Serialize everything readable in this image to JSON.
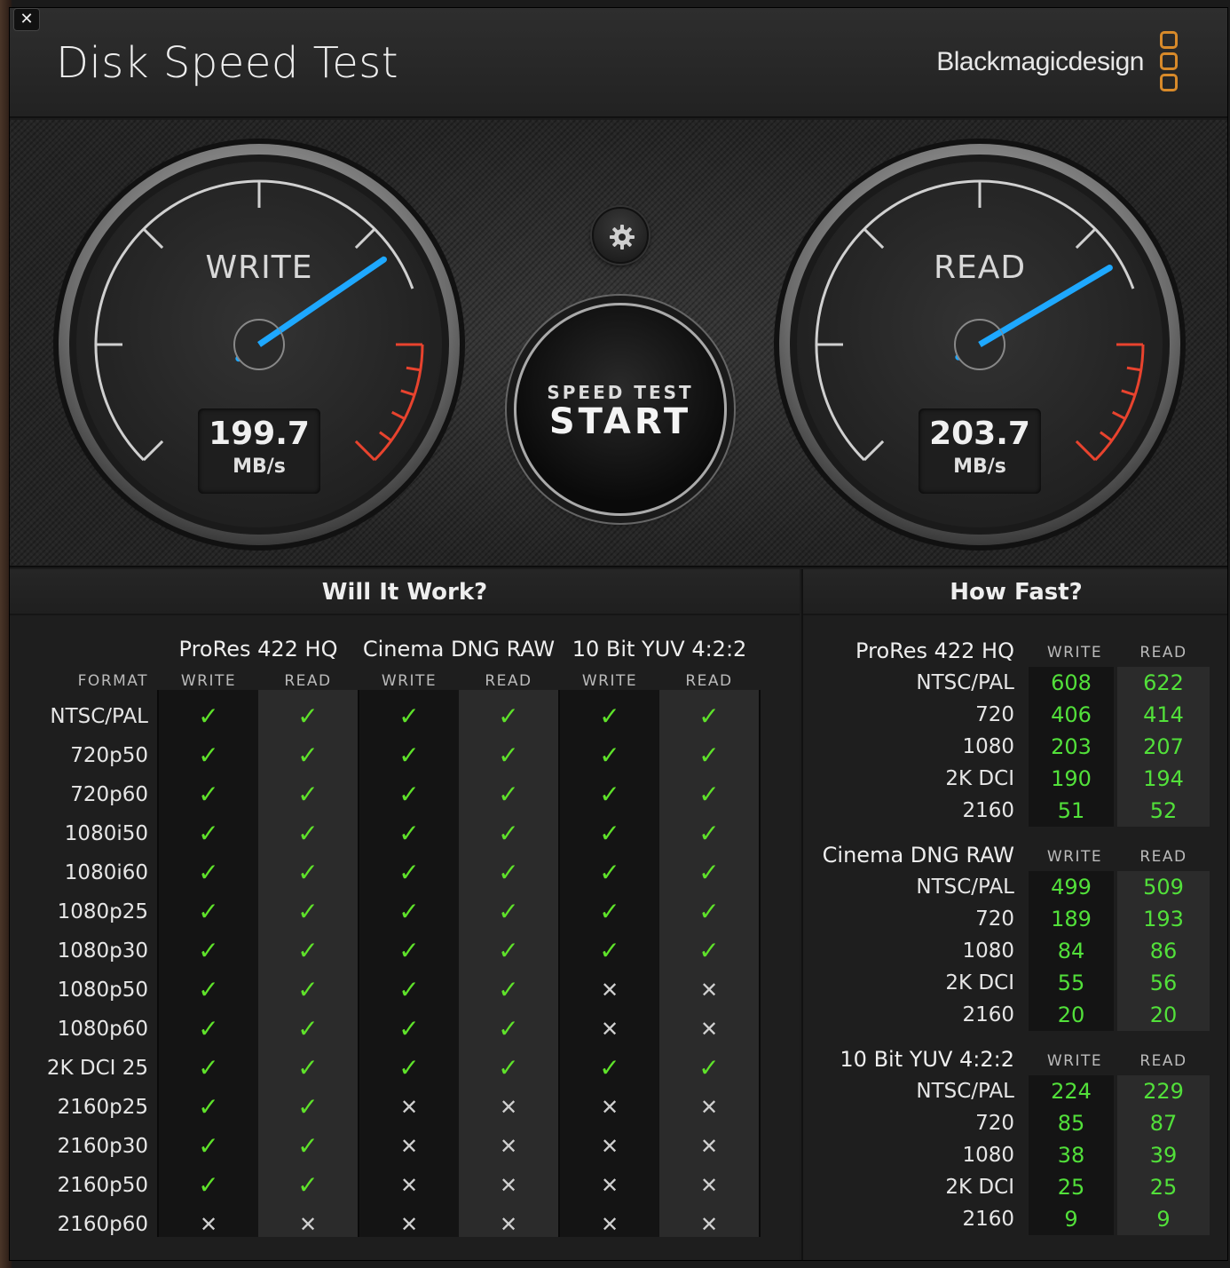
{
  "window": {
    "title": "Disk Speed Test",
    "brand": "Blackmagicdesign",
    "close_glyph": "✕"
  },
  "gauges": {
    "write": {
      "label": "WRITE",
      "value": "199.7",
      "unit": "MB/s"
    },
    "read": {
      "label": "READ",
      "value": "203.7",
      "unit": "MB/s"
    }
  },
  "controls": {
    "settings_icon": "gear-icon",
    "start_small": "SPEED TEST",
    "start_big": "START"
  },
  "will_it_work": {
    "title": "Will It Work?",
    "format_header": "FORMAT",
    "groups": [
      "ProRes 422 HQ",
      "Cinema DNG RAW",
      "10 Bit YUV 4:2:2"
    ],
    "col_write": "WRITE",
    "col_read": "READ",
    "yes_glyph": "✓",
    "no_glyph": "✕",
    "rows": [
      {
        "format": "NTSC/PAL",
        "v": [
          1,
          1,
          1,
          1,
          1,
          1
        ]
      },
      {
        "format": "720p50",
        "v": [
          1,
          1,
          1,
          1,
          1,
          1
        ]
      },
      {
        "format": "720p60",
        "v": [
          1,
          1,
          1,
          1,
          1,
          1
        ]
      },
      {
        "format": "1080i50",
        "v": [
          1,
          1,
          1,
          1,
          1,
          1
        ]
      },
      {
        "format": "1080i60",
        "v": [
          1,
          1,
          1,
          1,
          1,
          1
        ]
      },
      {
        "format": "1080p25",
        "v": [
          1,
          1,
          1,
          1,
          1,
          1
        ]
      },
      {
        "format": "1080p30",
        "v": [
          1,
          1,
          1,
          1,
          1,
          1
        ]
      },
      {
        "format": "1080p50",
        "v": [
          1,
          1,
          1,
          1,
          0,
          0
        ]
      },
      {
        "format": "1080p60",
        "v": [
          1,
          1,
          1,
          1,
          0,
          0
        ]
      },
      {
        "format": "2K DCI 25",
        "v": [
          1,
          1,
          1,
          1,
          1,
          1
        ]
      },
      {
        "format": "2160p25",
        "v": [
          1,
          1,
          0,
          0,
          0,
          0
        ]
      },
      {
        "format": "2160p30",
        "v": [
          1,
          1,
          0,
          0,
          0,
          0
        ]
      },
      {
        "format": "2160p50",
        "v": [
          1,
          1,
          0,
          0,
          0,
          0
        ]
      },
      {
        "format": "2160p60",
        "v": [
          0,
          0,
          0,
          0,
          0,
          0
        ]
      }
    ]
  },
  "how_fast": {
    "title": "How Fast?",
    "col_write": "WRITE",
    "col_read": "READ",
    "groups": [
      {
        "name": "ProRes 422 HQ",
        "rows": [
          {
            "label": "NTSC/PAL",
            "write": "608",
            "read": "622"
          },
          {
            "label": "720",
            "write": "406",
            "read": "414"
          },
          {
            "label": "1080",
            "write": "203",
            "read": "207"
          },
          {
            "label": "2K DCI",
            "write": "190",
            "read": "194"
          },
          {
            "label": "2160",
            "write": "51",
            "read": "52"
          }
        ]
      },
      {
        "name": "Cinema DNG RAW",
        "rows": [
          {
            "label": "NTSC/PAL",
            "write": "499",
            "read": "509"
          },
          {
            "label": "720",
            "write": "189",
            "read": "193"
          },
          {
            "label": "1080",
            "write": "84",
            "read": "86"
          },
          {
            "label": "2K DCI",
            "write": "55",
            "read": "56"
          },
          {
            "label": "2160",
            "write": "20",
            "read": "20"
          }
        ]
      },
      {
        "name": "10 Bit YUV 4:2:2",
        "rows": [
          {
            "label": "NTSC/PAL",
            "write": "224",
            "read": "229"
          },
          {
            "label": "720",
            "write": "85",
            "read": "87"
          },
          {
            "label": "1080",
            "write": "38",
            "read": "39"
          },
          {
            "label": "2K DCI",
            "write": "25",
            "read": "25"
          },
          {
            "label": "2160",
            "write": "9",
            "read": "9"
          }
        ]
      }
    ]
  },
  "colors": {
    "needle": "#1ea8ff",
    "redzone": "#e8432e",
    "ok": "#5fe22a",
    "number": "#52e03a",
    "brand_logo": "#d88a2a"
  }
}
